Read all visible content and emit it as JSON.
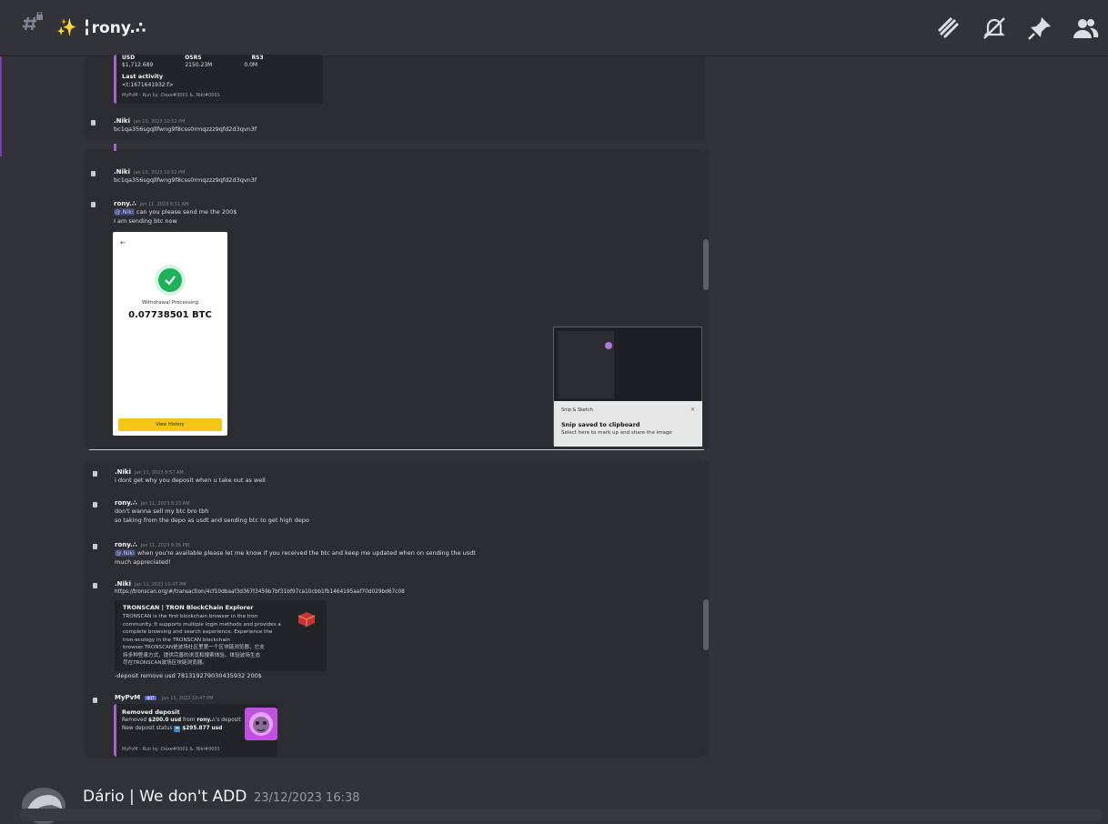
{
  "header": {
    "channel_emoji": "✨",
    "channel_name": "╏rony.∴",
    "icons": [
      "threads-icon",
      "mute-icon",
      "pin-icon",
      "members-icon"
    ]
  },
  "panel1": {
    "stat_labels": [
      "USD",
      "OSRS",
      "RS3"
    ],
    "stat_values": [
      "$1,712.689",
      "2150.23M",
      "0.0M"
    ],
    "last_activity_label": "Last activity",
    "last_activity_value": "<t:1671641932:f>",
    "footer": "MyPvM - Run by :Dáxe#0001 &. Niki#0001",
    "msg_name": ".Niki",
    "msg_time": "Jan 10, 2023 10:52 PM",
    "msg_text": "bc1qa356sgqllfwng9f8css0rmqzzz9qfd2d3qvn3f"
  },
  "panel2": {
    "msg1_name": ".Niki",
    "msg1_time": "Jan 10, 2023 10:52 PM",
    "msg1_text": "bc1qa356sgqllfwng9f8css0rmqzzz9qfd2d3qvn3f",
    "msg2_name": "rony.∴",
    "msg2_time": "Jan 11, 2023 8:51 AM",
    "msg2_mention": "@.Niki",
    "msg2_text1": " can you please send me the 200$",
    "msg2_text2": "I am sending btc now",
    "card_status": "Withdrawal Processing",
    "card_amount": "0.07738501 BTC",
    "card_button": "View History",
    "snip_app": "Snip & Sketch",
    "snip_title": "Snip saved to clipboard",
    "snip_sub": "Select here to mark up and share the image"
  },
  "panel3": {
    "m1_name": ".Niki",
    "m1_time": "Jan 11, 2023 8:57 AM",
    "m1_text": "i dont get why you deposit when u take out as well",
    "m2_name": "rony.∴",
    "m2_time": "Jan 11, 2023 8:23 AM",
    "m2_text1": "don't wanna sell my btc bro tbh",
    "m2_text2": "so taking from the depo as usdt and sending btc to get high depo",
    "m3_name": "rony.∴",
    "m3_time": "Jan 11, 2023 8:35 PM",
    "m3_mention": "@.Niki",
    "m3_text1": " when you're available please let me know if you received the btc and keep me updated when on sending the usdt",
    "m3_text2": "much appreciated!",
    "m4_name": ".Niki",
    "m4_time": "Jan 11, 2023 10:47 PM",
    "m4_link": "https://tronscan.org/#/transaction/4cf10dbaaf3d367f3459b7bf31bf97ca10cbb1fb1464195aaf70d029bd67c08",
    "embed_title": "TRONSCAN | TRON BlockChain Explorer",
    "embed_desc": [
      "TRONSCAN is the first blockchain browser in the tron",
      "community. It supports multiple login methods and provides a",
      "complete browsing and search experience. Experience the",
      "tron-ecology in the TRONSCAN blockchain",
      "browser.TRONSCAN是波场社区里第一个区块链浏览器，它支",
      "持多种登录方式，提供完善的浏览和搜索体验。体验波场生态",
      "尽在TRONSCAN波场区块链浏览器。"
    ],
    "m4_cmd": "-deposit remove usd 781319279030435932 200$",
    "m5_name": "MyPvM",
    "m5_bot": "BOT",
    "m5_time": "Jan 11, 2023 10:47 PM",
    "bot_title": "Removed deposit",
    "bot_line1_a": "Removed ",
    "bot_line1_b": "$200.0 usd",
    "bot_line1_c": " from ",
    "bot_line1_d": "rony.∴",
    "bot_line1_e": "'s deposit",
    "bot_line2_a": "New deposit status ",
    "bot_line2_b": "$295.877 usd",
    "bot_footer": "MyPvM - Run by :Dáxe#0001 &. Niki#0001"
  },
  "footer_message": {
    "author": "Dário | We don't ADD",
    "timestamp": "23/12/2023 16:38"
  },
  "colors": {
    "accent": "#a066c9",
    "link": "#00a8fc",
    "mention_bg": "#3c4270",
    "button": "#f5c518",
    "check": "#1eb15c"
  }
}
